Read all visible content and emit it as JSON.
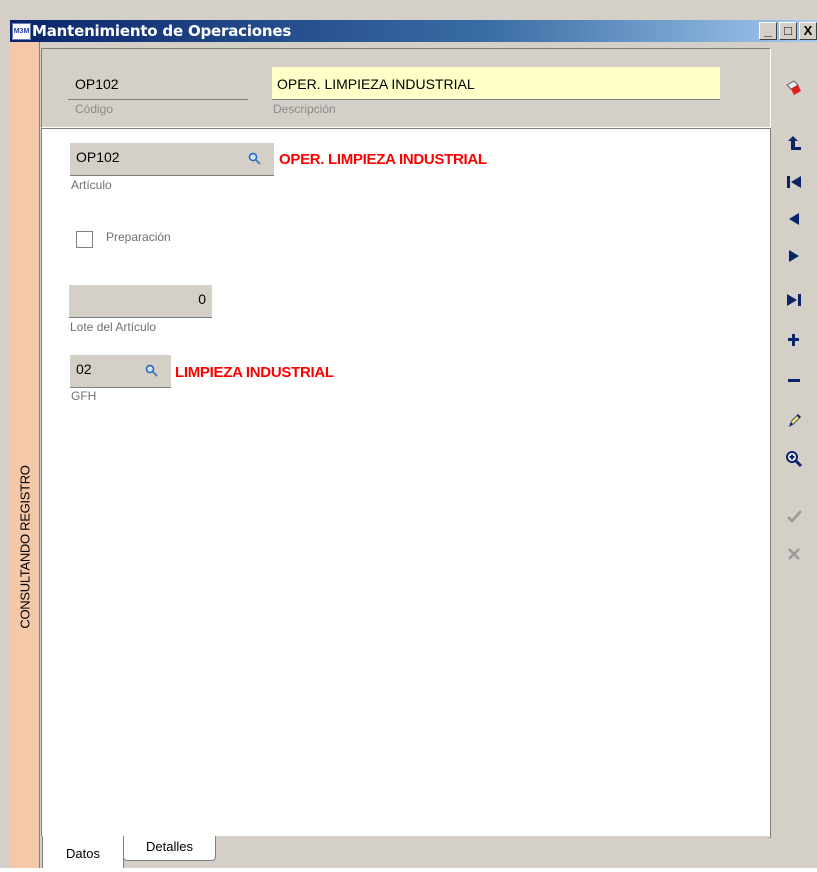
{
  "window": {
    "title": "Mantenimiento de Operaciones",
    "icon_text": "M3M",
    "controls": [
      "_",
      "□",
      "X"
    ]
  },
  "status_side_label": "CONSULTANDO REGISTRO",
  "header": {
    "codigo_value": "OP102",
    "codigo_label": "Código",
    "descripcion_value": "OPER. LIMPIEZA INDUSTRIAL",
    "descripcion_label": "Descripción"
  },
  "form": {
    "articulo_value": "OP102",
    "articulo_label": "Artículo",
    "articulo_desc": "OPER. LIMPIEZA INDUSTRIAL",
    "preparacion_label": "Preparación",
    "preparacion_checked": false,
    "lote_value": "0",
    "lote_label": "Lote del Artículo",
    "gfh_value": "02",
    "gfh_label": "GFH",
    "gfh_desc": "LIMPIEZA INDUSTRIAL"
  },
  "tabs": [
    {
      "label": "Datos",
      "active": true
    },
    {
      "label": "Detalles",
      "active": false
    }
  ],
  "toolbar_icons": [
    "eraser-icon",
    "up-arrow-icon",
    "first-record-icon",
    "previous-record-icon",
    "next-record-icon",
    "last-record-icon",
    "add-icon",
    "delete-icon",
    "edit-icon",
    "search-zoom-icon",
    "accept-icon",
    "cancel-icon"
  ],
  "colors": {
    "title_gradient_start": "#0a246a",
    "side_label_bg": "#f4c8a8",
    "description_bg": "#ffffc8",
    "highlight_text": "#ff0000",
    "toolbar_icon": "#0a246a"
  }
}
